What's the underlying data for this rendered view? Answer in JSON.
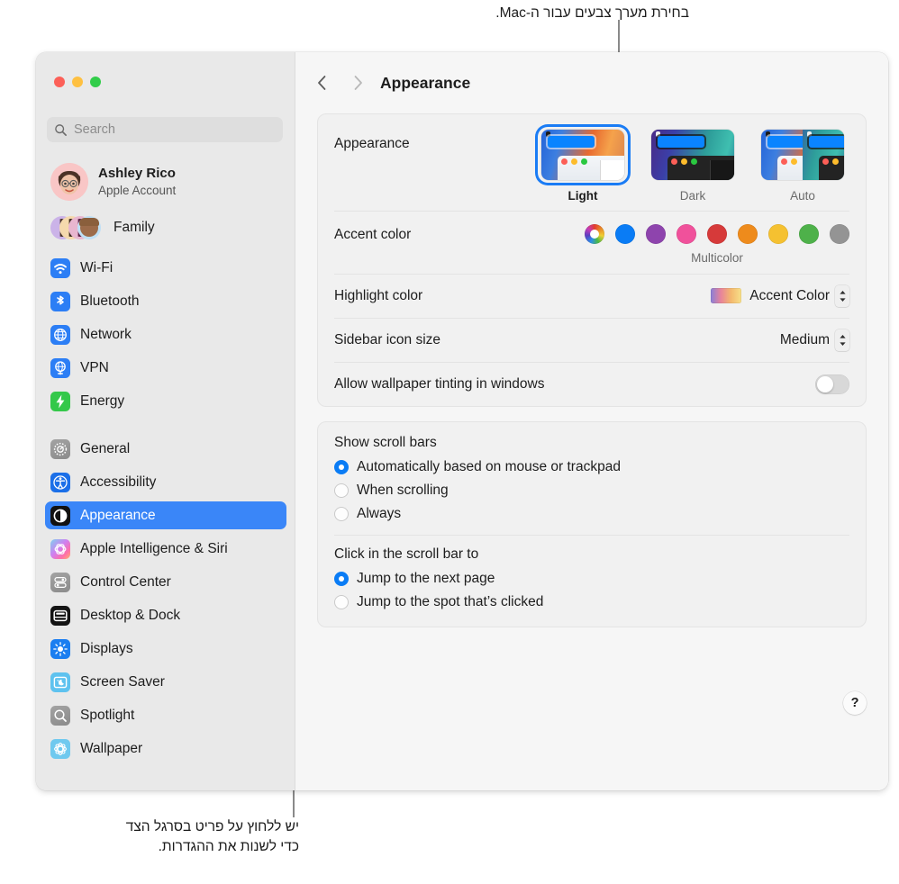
{
  "annotations": {
    "top": "בחירת מערך צבעים עבור ה-Mac.",
    "bottom": "יש ללחוץ על פריט בסרגל הצד\nכדי לשנות את ההגדרות."
  },
  "window": {
    "traffic_lights": [
      "close",
      "minimize",
      "zoom"
    ]
  },
  "sidebar": {
    "search": {
      "placeholder": "Search",
      "value": ""
    },
    "account": {
      "name": "Ashley Rico",
      "subtitle": "Apple Account"
    },
    "family": {
      "label": "Family"
    },
    "groups": [
      {
        "items": [
          {
            "label": "Wi-Fi",
            "icon": "wifi-icon"
          },
          {
            "label": "Bluetooth",
            "icon": "bluetooth-icon"
          },
          {
            "label": "Network",
            "icon": "network-icon"
          },
          {
            "label": "VPN",
            "icon": "vpn-icon"
          },
          {
            "label": "Energy",
            "icon": "energy-icon"
          }
        ]
      },
      {
        "items": [
          {
            "label": "General",
            "icon": "gear-icon"
          },
          {
            "label": "Accessibility",
            "icon": "accessibility-icon"
          },
          {
            "label": "Appearance",
            "icon": "appearance-icon",
            "selected": true
          },
          {
            "label": "Apple Intelligence & Siri",
            "icon": "siri-icon"
          },
          {
            "label": "Control Center",
            "icon": "control-center-icon"
          },
          {
            "label": "Desktop & Dock",
            "icon": "dock-icon"
          },
          {
            "label": "Displays",
            "icon": "displays-icon"
          },
          {
            "label": "Screen Saver",
            "icon": "screen-saver-icon"
          },
          {
            "label": "Spotlight",
            "icon": "spotlight-icon"
          },
          {
            "label": "Wallpaper",
            "icon": "wallpaper-icon"
          }
        ]
      }
    ]
  },
  "toolbar": {
    "back_icon": "chevron-left-icon",
    "forward_icon": "chevron-right-icon",
    "title": "Appearance"
  },
  "main": {
    "appearance": {
      "label": "Appearance",
      "options": [
        {
          "name": "Light",
          "selected": true
        },
        {
          "name": "Dark",
          "selected": false
        },
        {
          "name": "Auto",
          "selected": false
        }
      ]
    },
    "accent_color": {
      "label": "Accent color",
      "caption": "Multicolor",
      "selected_index": 0,
      "swatches": [
        {
          "name": "Multicolor",
          "color": "multicolor"
        },
        {
          "name": "Blue",
          "color": "#0a7cf5"
        },
        {
          "name": "Purple",
          "color": "#8e44ad"
        },
        {
          "name": "Pink",
          "color": "#f0519b"
        },
        {
          "name": "Red",
          "color": "#d63a3a"
        },
        {
          "name": "Orange",
          "color": "#ee8b1c"
        },
        {
          "name": "Yellow",
          "color": "#f5c131"
        },
        {
          "name": "Green",
          "color": "#4eb14a"
        },
        {
          "name": "Graphite",
          "color": "#949494"
        }
      ]
    },
    "highlight_color": {
      "label": "Highlight color",
      "value": "Accent Color"
    },
    "sidebar_icon_size": {
      "label": "Sidebar icon size",
      "value": "Medium"
    },
    "wallpaper_tinting": {
      "label": "Allow wallpaper tinting in windows",
      "state": "off"
    },
    "show_scroll_bars": {
      "label": "Show scroll bars",
      "options": [
        {
          "label": "Automatically based on mouse or trackpad",
          "selected": true
        },
        {
          "label": "When scrolling",
          "selected": false
        },
        {
          "label": "Always",
          "selected": false
        }
      ]
    },
    "click_scroll_bar": {
      "label": "Click in the scroll bar to",
      "options": [
        {
          "label": "Jump to the next page",
          "selected": true
        },
        {
          "label": "Jump to the spot that’s clicked",
          "selected": false
        }
      ]
    },
    "help": {
      "label": "?"
    }
  }
}
